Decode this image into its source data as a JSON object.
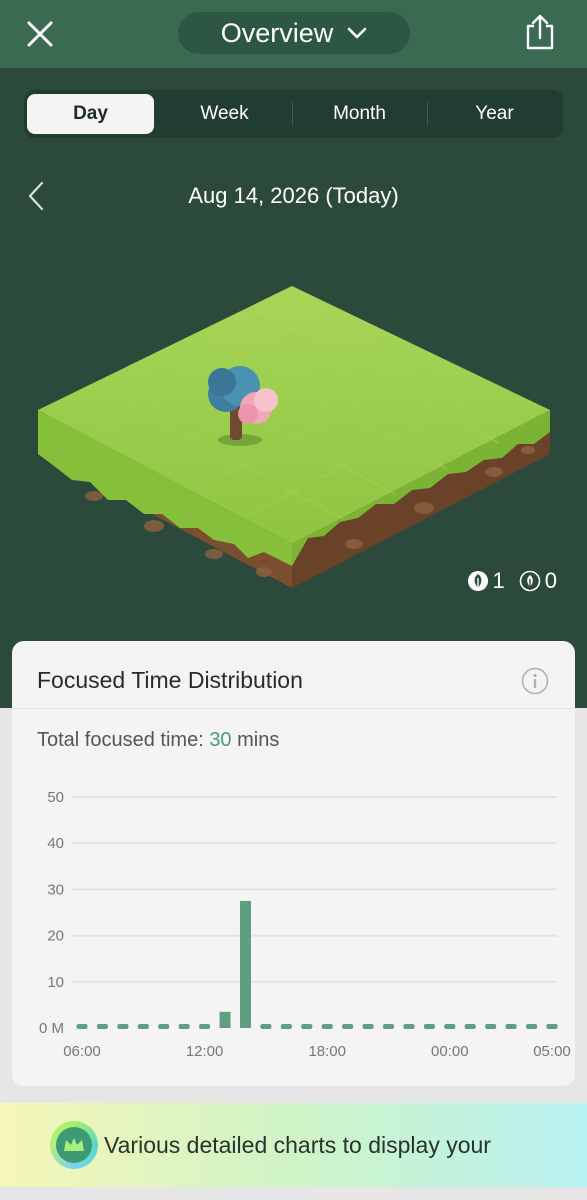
{
  "header": {
    "title": "Overview",
    "close_icon": "close-icon",
    "dropdown_icon": "chevron-down-icon",
    "share_icon": "share-icon"
  },
  "period_tabs": [
    {
      "label": "Day",
      "selected": true
    },
    {
      "label": "Week",
      "selected": false
    },
    {
      "label": "Month",
      "selected": false
    },
    {
      "label": "Year",
      "selected": false
    }
  ],
  "date_nav": {
    "date": "Aug 14, 2026 (Today)",
    "prev_icon": "chevron-left-icon"
  },
  "forest": {
    "healthy_trees": "1",
    "withered_trees": "0",
    "healthy_icon": "leaf-icon",
    "withered_icon": "withered-leaf-icon"
  },
  "focus_card": {
    "title": "Focused Time Distribution",
    "info_icon": "info-icon",
    "total_label": "Total focused time:",
    "total_value": "30",
    "total_unit": "mins"
  },
  "chart_data": {
    "type": "bar",
    "y_ticks": [
      "0 M",
      "10",
      "20",
      "30",
      "40",
      "50"
    ],
    "ylim": [
      0,
      50
    ],
    "x_ticks": [
      "06:00",
      "12:00",
      "18:00",
      "00:00",
      "05:00"
    ],
    "bar_count": 24,
    "values": [
      0,
      0,
      0,
      0,
      0,
      0,
      0,
      3.5,
      27.5,
      0,
      0,
      0,
      0,
      0,
      0,
      0,
      0,
      0,
      0,
      0,
      0,
      0,
      0,
      0
    ],
    "bar_color": "#5f9f80",
    "empty_color": "#5f9f80",
    "grid": true
  },
  "promo": {
    "text": "Various detailed charts to display your",
    "icon": "crown-icon"
  },
  "colors": {
    "accent": "#4d9b77",
    "header_bg": "#3b6a52",
    "page_bg": "#2c4a3c"
  }
}
